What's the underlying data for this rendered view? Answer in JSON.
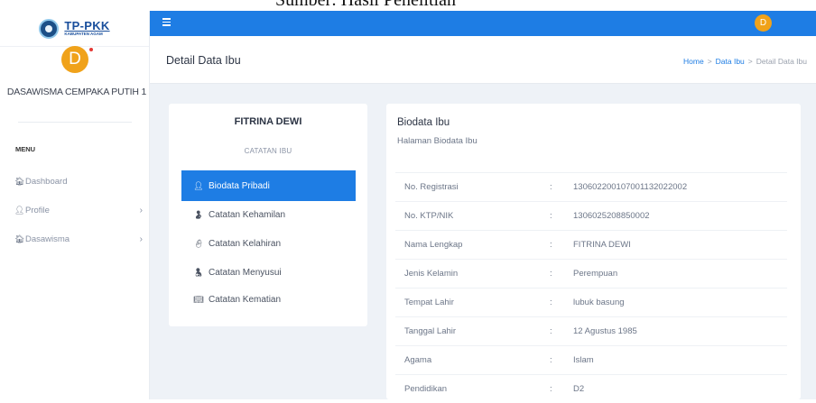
{
  "caption": "Sumber: Hasil Penelitian",
  "sidebar": {
    "logo_main": "TP-PKK",
    "logo_sub": "KABUPATEN AGAM",
    "avatar_letter": "D",
    "user_name": "DASAWISMA CEMPAKA PUTIH 1",
    "menu_heading": "MENU",
    "items": [
      {
        "label": "Dashboard",
        "icon": "home-icon"
      },
      {
        "label": "Profile",
        "icon": "user-icon"
      },
      {
        "label": "Dasawisma",
        "icon": "home-icon"
      }
    ]
  },
  "topbar": {
    "menu_icon": "hamburger-icon",
    "avatar_letter": "D",
    "color": "#1e7de4"
  },
  "header": {
    "title": "Detail Data Ibu",
    "breadcrumb": [
      "Home",
      "Data Ibu",
      "Detail Data Ibu"
    ],
    "separator": ">"
  },
  "profile_card": {
    "name": "FITRINA DEWI",
    "subtitle": "CATATAN IBU",
    "menu": [
      {
        "label": "Biodata Pribadi",
        "icon": "user-icon",
        "active": true
      },
      {
        "label": "Catatan Kehamilan",
        "icon": "pregnant-icon",
        "active": false
      },
      {
        "label": "Catatan Kelahiran",
        "icon": "baby-icon",
        "active": false
      },
      {
        "label": "Catatan Menyusui",
        "icon": "breastfeeding-icon",
        "active": false
      },
      {
        "label": "Catatan Kematian",
        "icon": "book-icon",
        "active": false
      }
    ]
  },
  "biodata": {
    "title": "Biodata Ibu",
    "subtitle": "Halaman Biodata Ibu",
    "colon": ":",
    "rows": [
      {
        "label": "No. Registrasi",
        "value": "130602200107001132022002"
      },
      {
        "label": "No. KTP/NIK",
        "value": "1306025208850002"
      },
      {
        "label": "Nama Lengkap",
        "value": "FITRINA DEWI"
      },
      {
        "label": "Jenis Kelamin",
        "value": "Perempuan"
      },
      {
        "label": "Tempat Lahir",
        "value": "lubuk basung"
      },
      {
        "label": "Tanggal Lahir",
        "value": "12 Agustus 1985"
      },
      {
        "label": "Agama",
        "value": "Islam"
      },
      {
        "label": "Pendidikan",
        "value": "D2"
      }
    ]
  }
}
